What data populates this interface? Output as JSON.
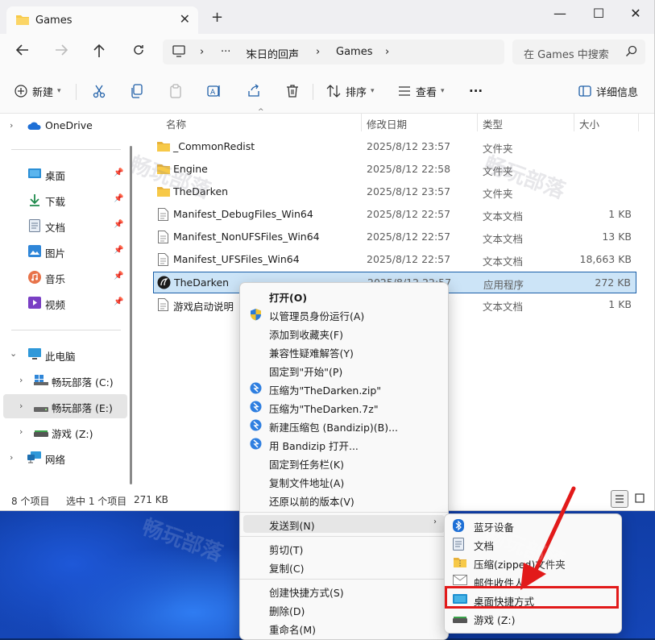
{
  "window": {
    "tab_title": "Games",
    "new_tab": "+",
    "minimize": "—",
    "maximize": "☐",
    "close": "✕"
  },
  "address": {
    "ellipsis": "···",
    "crumbs": [
      "末日的回声",
      "Games"
    ],
    "separator": "›",
    "search_placeholder": "在 Games 中搜索"
  },
  "toolbar": {
    "new_label": "新建",
    "sort_label": "排序",
    "view_label": "查看",
    "more_label": "···",
    "details_label": "详细信息"
  },
  "sidebar": {
    "onedrive": "OneDrive",
    "quick": [
      {
        "label": "桌面",
        "icon": "desktop-icon"
      },
      {
        "label": "下载",
        "icon": "download-icon"
      },
      {
        "label": "文档",
        "icon": "document-icon"
      },
      {
        "label": "图片",
        "icon": "pictures-icon"
      },
      {
        "label": "音乐",
        "icon": "music-icon"
      },
      {
        "label": "视频",
        "icon": "video-icon"
      }
    ],
    "this_pc": "此电脑",
    "drives": [
      {
        "label": "畅玩部落 (C:)"
      },
      {
        "label": "畅玩部落 (E:)"
      },
      {
        "label": "游戏 (Z:)"
      }
    ],
    "network": "网络"
  },
  "columns": {
    "name": "名称",
    "modified": "修改日期",
    "type": "类型",
    "size": "大小"
  },
  "files": [
    {
      "name": "_CommonRedist",
      "date": "2025/8/12 23:57",
      "type": "文件夹",
      "size": "",
      "icon": "folder-icon"
    },
    {
      "name": "Engine",
      "date": "2025/8/12 22:58",
      "type": "文件夹",
      "size": "",
      "icon": "folder-icon"
    },
    {
      "name": "TheDarken",
      "date": "2025/8/12 23:57",
      "type": "文件夹",
      "size": "",
      "icon": "folder-icon"
    },
    {
      "name": "Manifest_DebugFiles_Win64",
      "date": "2025/8/12 22:57",
      "type": "文本文档",
      "size": "1 KB",
      "icon": "text-file-icon"
    },
    {
      "name": "Manifest_NonUFSFiles_Win64",
      "date": "2025/8/12 22:57",
      "type": "文本文档",
      "size": "13 KB",
      "icon": "text-file-icon"
    },
    {
      "name": "Manifest_UFSFiles_Win64",
      "date": "2025/8/12 22:57",
      "type": "文本文档",
      "size": "18,663 KB",
      "icon": "text-file-icon"
    },
    {
      "name": "TheDarken",
      "date": "2025/8/12 22:57",
      "type": "应用程序",
      "size": "272 KB",
      "icon": "app-icon"
    },
    {
      "name": "游戏启动说明",
      "date": "",
      "type": "文本文档",
      "size": "1 KB",
      "icon": "text-file-icon"
    }
  ],
  "status": {
    "count": "8 个项目",
    "selected": "选中 1 个项目",
    "size": "271 KB"
  },
  "context_menu": {
    "items": [
      {
        "label": "打开(O)",
        "bold": true
      },
      {
        "label": "以管理员身份运行(A)",
        "icon": "shield-icon"
      },
      {
        "label": "添加到收藏夹(F)"
      },
      {
        "label": "兼容性疑难解答(Y)"
      },
      {
        "label": "固定到\"开始\"(P)"
      },
      {
        "label": "压缩为\"TheDarken.zip\"",
        "icon": "bandizip-icon"
      },
      {
        "label": "压缩为\"TheDarken.7z\"",
        "icon": "bandizip-icon"
      },
      {
        "label": "新建压缩包 (Bandizip)(B)...",
        "icon": "bandizip-icon"
      },
      {
        "label": "用 Bandizip 打开...",
        "icon": "bandizip-icon"
      },
      {
        "label": "固定到任务栏(K)"
      },
      {
        "label": "复制文件地址(A)"
      },
      {
        "label": "还原以前的版本(V)"
      },
      {
        "label": "发送到(N)",
        "arrow": "›"
      },
      {
        "label": "剪切(T)"
      },
      {
        "label": "复制(C)"
      },
      {
        "label": "创建快捷方式(S)"
      },
      {
        "label": "删除(D)"
      },
      {
        "label": "重命名(M)"
      }
    ]
  },
  "send_to": {
    "items": [
      {
        "label": "蓝牙设备",
        "icon": "bluetooth-icon"
      },
      {
        "label": "文档",
        "icon": "document-icon"
      },
      {
        "label": "压缩(zipped)文件夹",
        "icon": "zip-folder-icon"
      },
      {
        "label": "邮件收件人",
        "icon": "mail-icon"
      },
      {
        "label": "桌面快捷方式",
        "icon": "desktop-icon"
      },
      {
        "label": "游戏 (Z:)",
        "icon": "drive-icon"
      }
    ]
  },
  "watermark": "畅玩部落",
  "colors": {
    "highlight_red": "#e21a1a",
    "selection_blue": "#cce4f7",
    "folder_yellow": "#f7c948"
  }
}
